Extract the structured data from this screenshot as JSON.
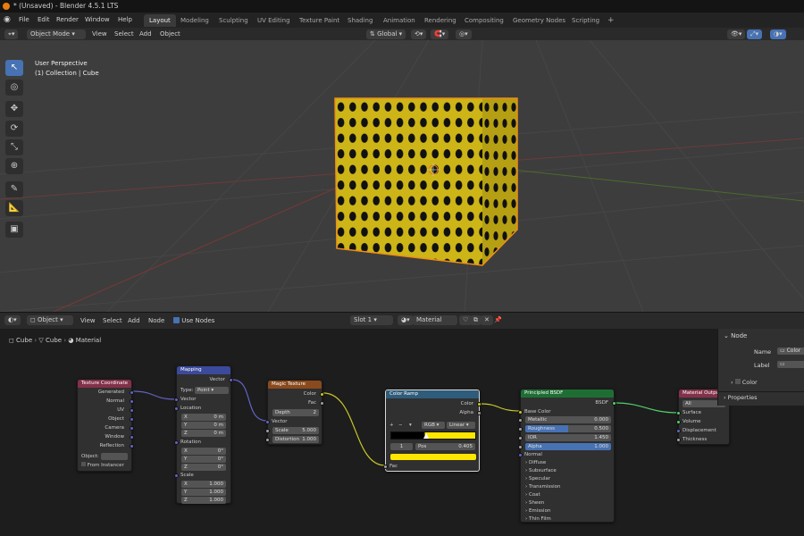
{
  "window": {
    "title": "* (Unsaved) - Blender 4.5.1 LTS"
  },
  "menu": {
    "items": [
      "File",
      "Edit",
      "Render",
      "Window",
      "Help"
    ]
  },
  "workspaces": {
    "tabs": [
      "Layout",
      "Modeling",
      "Sculpting",
      "UV Editing",
      "Texture Paint",
      "Shading",
      "Animation",
      "Rendering",
      "Compositing",
      "Geometry Nodes",
      "Scripting"
    ],
    "active": "Layout",
    "add": "+"
  },
  "viewport": {
    "mode": "Object Mode",
    "menus": [
      "View",
      "Select",
      "Add",
      "Object"
    ],
    "orientation": "Global",
    "overlay_line1": "User Perspective",
    "overlay_line2": "(1) Collection | Cube",
    "cube_color": "#d9c117",
    "dot_color": "#111111",
    "outline_color": "#f08e14"
  },
  "node_editor": {
    "object_type": "Object",
    "menus": [
      "View",
      "Select",
      "Add",
      "Node"
    ],
    "use_nodes": "Use Nodes",
    "slot": "Slot 1",
    "material": "Material",
    "breadcrumb": [
      "Cube",
      "Cube",
      "Material"
    ]
  },
  "nodes": {
    "texcoord": {
      "title": "Texture Coordinate",
      "outputs": [
        "Generated",
        "Normal",
        "UV",
        "Object",
        "Camera",
        "Window",
        "Reflection"
      ],
      "object_label": "Object:",
      "from_instancer": "From Instancer"
    },
    "mapping": {
      "title": "Mapping",
      "vector_out": "Vector",
      "type_label": "Type:",
      "type_value": "Point",
      "vector_in": "Vector",
      "location": "Location",
      "rotation": "Rotation",
      "scale": "Scale",
      "loc": [
        [
          "X",
          "0 m"
        ],
        [
          "Y",
          "0 m"
        ],
        [
          "Z",
          "0 m"
        ]
      ],
      "rot": [
        [
          "X",
          "0°"
        ],
        [
          "Y",
          "0°"
        ],
        [
          "Z",
          "0°"
        ]
      ],
      "scl": [
        [
          "X",
          "1.000"
        ],
        [
          "Y",
          "1.000"
        ],
        [
          "Z",
          "1.000"
        ]
      ]
    },
    "magic": {
      "title": "Magic Texture",
      "color_out": "Color",
      "fac_out": "Fac",
      "depth_label": "Depth",
      "depth_value": "2",
      "vector_in": "Vector",
      "scale_label": "Scale",
      "scale_value": "5.000",
      "distortion_label": "Distortion",
      "distortion_value": "1.000"
    },
    "ramp": {
      "title": "Color Ramp",
      "color_out": "Color",
      "alpha_out": "Alpha",
      "mode": "RGB",
      "interp": "Linear",
      "stop_index": "1",
      "pos_label": "Pos",
      "pos_value": "0.405",
      "fac_in": "Fac",
      "ramp_color": "#ffe600"
    },
    "bsdf": {
      "title": "Principled BSDF",
      "bsdf_out": "BSDF",
      "base_color": "Base Color",
      "metallic_label": "Metallic",
      "metallic_value": "0.000",
      "roughness_label": "Roughness",
      "roughness_value": "0.500",
      "ior_label": "IOR",
      "ior_value": "1.450",
      "alpha_label": "Alpha",
      "alpha_value": "1.000",
      "normal": "Normal",
      "panels": [
        "Diffuse",
        "Subsurface",
        "Specular",
        "Transmission",
        "Coat",
        "Sheen",
        "Emission",
        "Thin Film"
      ]
    },
    "output": {
      "title": "Material Output",
      "target": "All",
      "inputs": [
        "Surface",
        "Volume",
        "Displacement",
        "Thickness"
      ]
    }
  },
  "side_panel": {
    "node_header": "Node",
    "name_label": "Name",
    "name_value": "Color",
    "label_label": "Label",
    "color_section": "Color",
    "properties_section": "Properties"
  }
}
